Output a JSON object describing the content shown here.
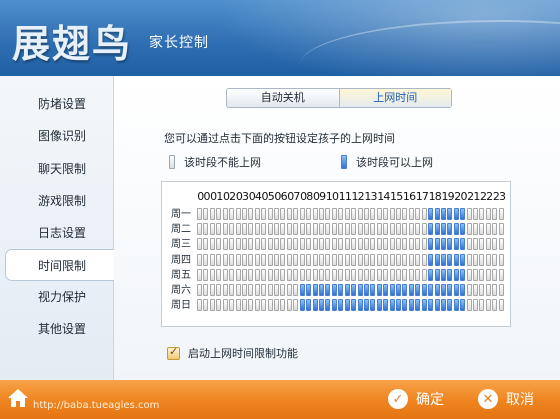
{
  "header": {
    "logo_text": "展翅鸟",
    "subtitle": "家长控制"
  },
  "sidebar": {
    "items": [
      {
        "label": "防堵设置"
      },
      {
        "label": "图像识别"
      },
      {
        "label": "聊天限制"
      },
      {
        "label": "游戏限制"
      },
      {
        "label": "日志设置"
      },
      {
        "label": "时间限制",
        "active": true
      },
      {
        "label": "视力保护"
      },
      {
        "label": "其他设置"
      }
    ]
  },
  "tabs": [
    {
      "label": "自动关机"
    },
    {
      "label": "上网时间",
      "selected": true
    }
  ],
  "instruction": "您可以通过点击下面的按钮设定孩子的上网时间",
  "legend": {
    "blocked_label": "该时段不能上网",
    "allowed_label": "该时段可以上网"
  },
  "schedule": {
    "hours": [
      "00",
      "01",
      "02",
      "03",
      "04",
      "05",
      "06",
      "07",
      "08",
      "09",
      "10",
      "11",
      "12",
      "13",
      "14",
      "15",
      "16",
      "17",
      "18",
      "19",
      "20",
      "21",
      "22",
      "23"
    ],
    "days": [
      "周一",
      "周二",
      "周三",
      "周四",
      "周五",
      "周六",
      "周日"
    ],
    "allowed_ranges": [
      [
        [
          18,
          21
        ]
      ],
      [
        [
          18,
          21
        ]
      ],
      [
        [
          18,
          21
        ]
      ],
      [
        [
          18,
          21
        ]
      ],
      [
        [
          18,
          21
        ]
      ],
      [
        [
          8,
          21
        ]
      ],
      [
        [
          8,
          21
        ]
      ]
    ]
  },
  "enable_option": {
    "label": "启动上网时间限制功能",
    "checked": true
  },
  "footer": {
    "url": "http://baba.tueagles.com",
    "ok_label": "确定",
    "cancel_label": "取消"
  },
  "colors": {
    "header_blue": "#2f6fb3",
    "footer_orange": "#ef8622",
    "cell_on": "#2f72d8",
    "cell_off": "#dcdcdc"
  }
}
